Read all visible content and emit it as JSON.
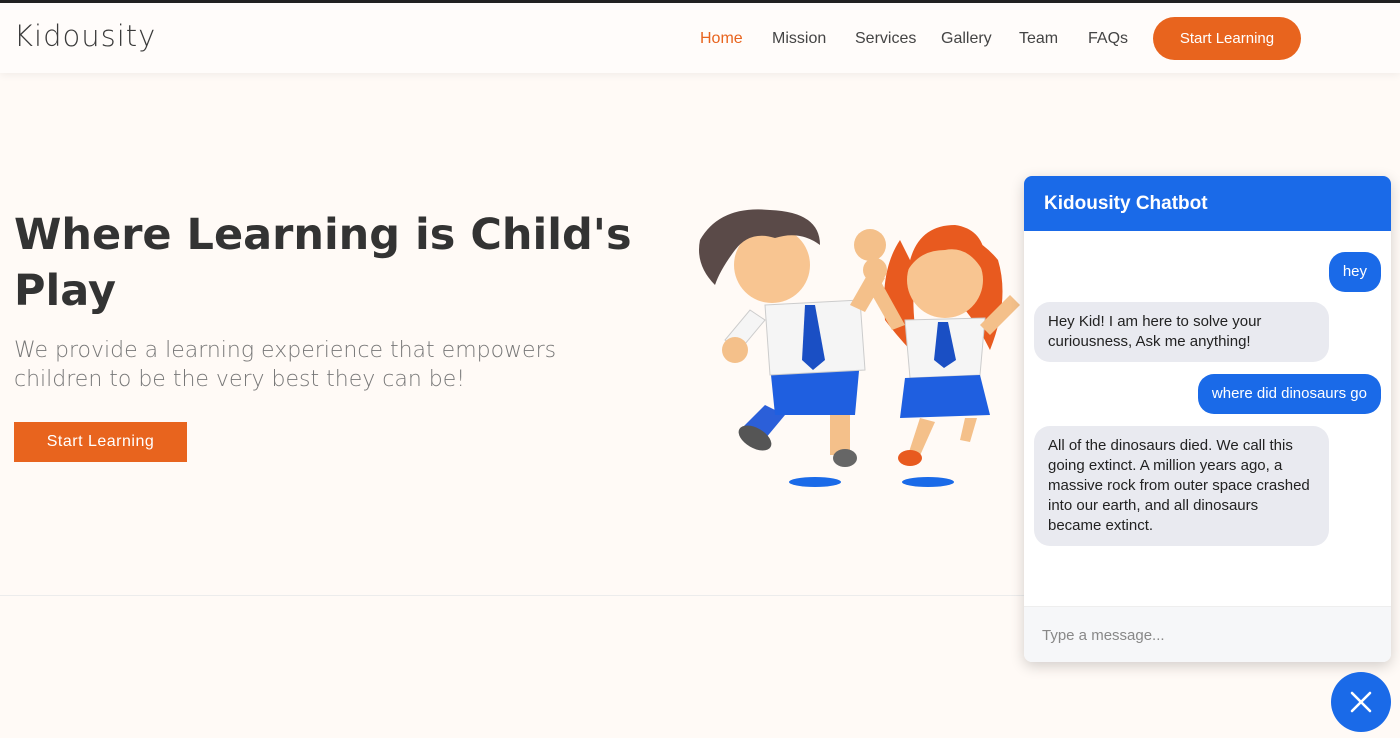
{
  "brand": {
    "name": "Kidousity"
  },
  "nav": {
    "items": [
      {
        "label": "Home",
        "active": true
      },
      {
        "label": "Mission"
      },
      {
        "label": "Services"
      },
      {
        "label": "Gallery"
      },
      {
        "label": "Team"
      },
      {
        "label": "FAQs"
      }
    ],
    "cta_label": "Start Learning"
  },
  "hero": {
    "title": "Where Learning is Child's Play",
    "subtitle": "We provide a learning experience that empowers children to be the very best they can be!",
    "button_label": "Start Learning"
  },
  "chatbot": {
    "title": "Kidousity Chatbot",
    "messages": [
      {
        "sender": "user",
        "text": "hey"
      },
      {
        "sender": "bot",
        "text": "Hey Kid! I am here to solve your curiousness, Ask me anything!"
      },
      {
        "sender": "user",
        "text": "where did dinosaurs go"
      },
      {
        "sender": "bot",
        "text": "All of the dinosaurs died. We call this going extinct. A million years ago, a massive rock from outer space crashed into our earth, and all dinosaurs became extinct."
      }
    ],
    "input": {
      "placeholder": "Type a message...",
      "value": ""
    },
    "close_icon": "close-icon"
  },
  "colors": {
    "accent": "#e8641e",
    "chat_blue": "#1a6ae8",
    "bot_bubble": "#e9eaf0"
  }
}
